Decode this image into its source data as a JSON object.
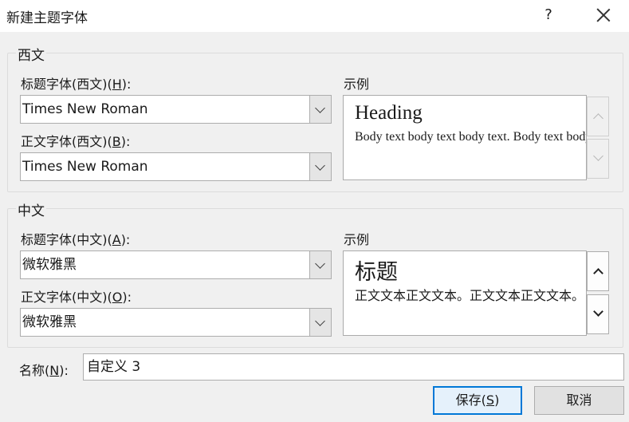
{
  "window": {
    "title": "新建主题字体",
    "help_label": "?"
  },
  "western": {
    "group_label": "西文",
    "heading_font_label_pre": "标题字体(西文)(",
    "heading_font_key": "H",
    "heading_font_label_post": "):",
    "heading_font_value": "Times New Roman",
    "body_font_label_pre": "正文字体(西文)(",
    "body_font_key": "B",
    "body_font_label_post": "):",
    "body_font_value": "Times New Roman",
    "sample_label": "示例",
    "sample_heading": "Heading",
    "sample_body": "Body text body text body text. Body text body text."
  },
  "chinese": {
    "group_label": "中文",
    "heading_font_label_pre": "标题字体(中文)(",
    "heading_font_key": "A",
    "heading_font_label_post": "):",
    "heading_font_value": "微软雅黑",
    "body_font_label_pre": "正文字体(中文)(",
    "body_font_key": "O",
    "body_font_label_post": "):",
    "body_font_value": "微软雅黑",
    "sample_label": "示例",
    "sample_heading": "标题",
    "sample_body": "正文文本正文文本。正文文本正文文本。"
  },
  "name": {
    "label_pre": "名称(",
    "label_key": "N",
    "label_post": "):",
    "value": "自定义 3"
  },
  "buttons": {
    "save_pre": "保存(",
    "save_key": "S",
    "save_post": ")",
    "cancel": "取消"
  },
  "colors": {
    "accent": "#0078d7",
    "dialog_bg": "#f0f0f0"
  }
}
